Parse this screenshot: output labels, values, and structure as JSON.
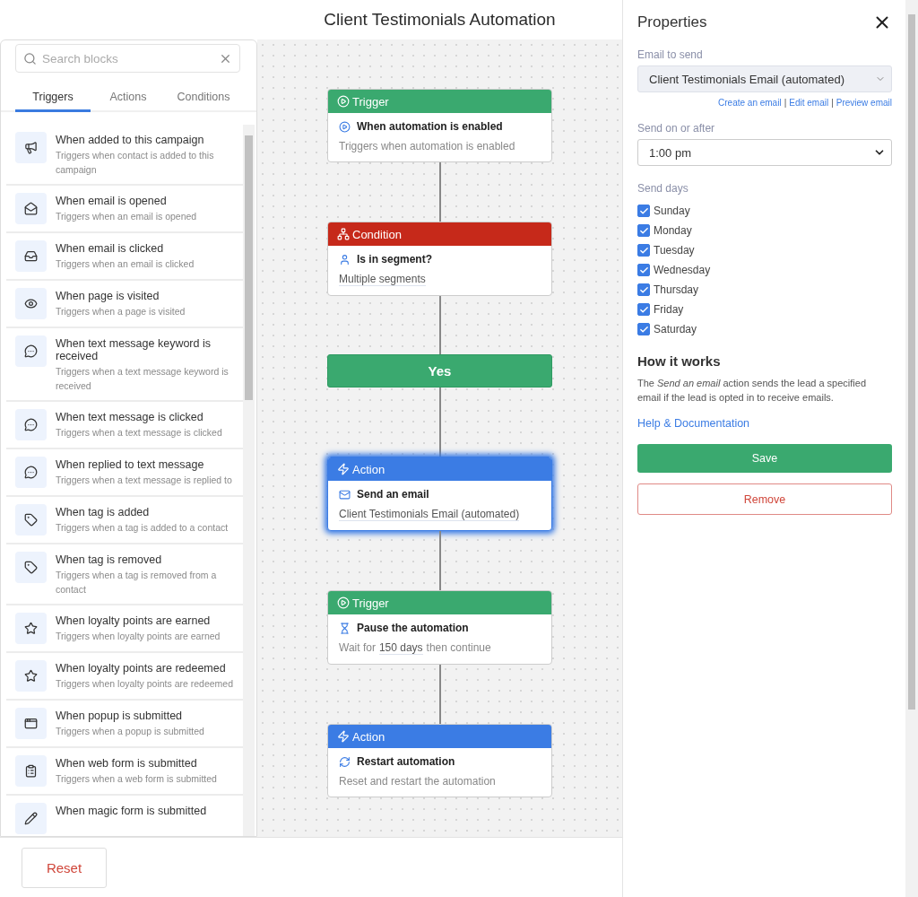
{
  "title": "Client Testimonials Automation",
  "search": {
    "placeholder": "Search blocks"
  },
  "tabs": [
    {
      "label": "Triggers",
      "selected": true
    },
    {
      "label": "Actions",
      "selected": false
    },
    {
      "label": "Conditions",
      "selected": false
    }
  ],
  "blocks": [
    {
      "title": "When added to this campaign",
      "description": "Triggers when contact is added to this campaign"
    },
    {
      "title": "When email is opened",
      "description": "Triggers when an email is opened"
    },
    {
      "title": "When email is clicked",
      "description": "Triggers when an email is clicked"
    },
    {
      "title": "When page is visited",
      "description": "Triggers when a page is visited"
    },
    {
      "title": "When text message keyword is received",
      "description": "Triggers when a text message keyword is received"
    },
    {
      "title": "When text message is clicked",
      "description": "Triggers when a text message is clicked"
    },
    {
      "title": "When replied to text message",
      "description": "Triggers when a text message is replied to"
    },
    {
      "title": "When tag is added",
      "description": "Triggers when a tag is added to a contact"
    },
    {
      "title": "When tag is removed",
      "description": "Triggers when a tag is removed from a contact"
    },
    {
      "title": "When loyalty points are earned",
      "description": "Triggers when loyalty points are earned"
    },
    {
      "title": "When loyalty points are redeemed",
      "description": "Triggers when loyalty points are redeemed"
    },
    {
      "title": "When popup is submitted",
      "description": "Triggers when a popup is submitted"
    },
    {
      "title": "When web form is submitted",
      "description": "Triggers when a web form is submitted"
    },
    {
      "title": "When magic form is submitted"
    }
  ],
  "nodes": [
    {
      "kind": "trigger",
      "header": "Trigger",
      "title": "When automation is enabled",
      "detail": [
        {
          "text": "Triggers when automation is enabled",
          "underlined": false
        }
      ],
      "selected": false
    },
    {
      "kind": "condition",
      "header": "Condition",
      "title": "Is in segment?",
      "detail": [
        {
          "text": "Multiple segments",
          "underlined": true
        }
      ],
      "selected": false
    },
    {
      "kind": "branch",
      "header": "Yes",
      "selected": false
    },
    {
      "kind": "action",
      "header": "Action",
      "title": "Send an email",
      "detail": [
        {
          "text": "Client Testimonials Email (automated)",
          "underlined": true
        }
      ],
      "selected": true
    },
    {
      "kind": "trigger",
      "header": "Trigger",
      "title": "Pause the automation",
      "detail": [
        {
          "text": "Wait for",
          "underlined": false
        },
        {
          "text": "150 days",
          "underlined": true
        },
        {
          "text": "then continue",
          "underlined": false
        }
      ],
      "selected": false
    },
    {
      "kind": "action",
      "header": "Action",
      "title": "Restart automation",
      "detail": [
        {
          "text": "Reset and restart the automation",
          "underlined": false
        }
      ],
      "selected": false
    }
  ],
  "reset": "Reset",
  "properties": {
    "title": "Properties",
    "email_label": "Email to send",
    "email_value": "Client Testimonials Email (automated)",
    "links": [
      "Create an email",
      "Edit email",
      "Preview email"
    ],
    "link_separator": "|",
    "time_label": "Send on or after",
    "time_value": "1:00 pm",
    "days_label": "Send days",
    "days": [
      {
        "label": "Sunday",
        "checked": true
      },
      {
        "label": "Monday",
        "checked": true
      },
      {
        "label": "Tuesday",
        "checked": true
      },
      {
        "label": "Wednesday",
        "checked": true
      },
      {
        "label": "Thursday",
        "checked": true
      },
      {
        "label": "Friday",
        "checked": true
      },
      {
        "label": "Saturday",
        "checked": true
      }
    ],
    "how_title": "How it works",
    "how_text": "The *Send an email* action sends the lead a specified email if the lead is opted in to receive emails.",
    "help_link": "Help & Documentation",
    "save": "Save",
    "remove": "Remove"
  }
}
